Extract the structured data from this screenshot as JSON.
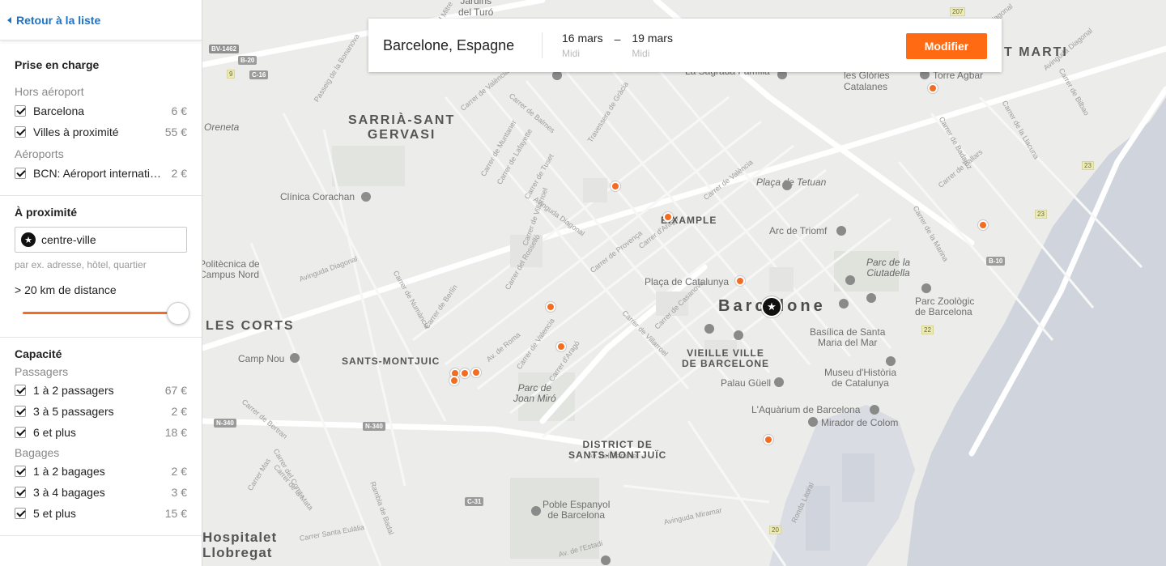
{
  "sidebar": {
    "back_label": "Retour à la liste",
    "pickup": {
      "title": "Prise en charge",
      "group_off_airport": "Hors aéroport",
      "off_airport": [
        {
          "label": "Barcelona",
          "price": "6 €"
        },
        {
          "label": "Villes à proximité",
          "price": "55 €"
        }
      ],
      "group_airports": "Aéroports",
      "airports": [
        {
          "label": "BCN: Aéroport international de Barcelone",
          "price": "2 €"
        }
      ]
    },
    "nearby": {
      "title": "À proximité",
      "input_value": "centre-ville",
      "hint": "par ex. adresse, hôtel, quartier",
      "distance_label": "> 20 km de distance",
      "slider_level": 1.0
    },
    "capacity": {
      "title": "Capacité",
      "group_passengers": "Passagers",
      "passengers": [
        {
          "label": "1 à 2 passagers",
          "price": "67 €"
        },
        {
          "label": "3 à 5 passagers",
          "price": "2 €"
        },
        {
          "label": "6 et plus",
          "price": "18 €"
        }
      ],
      "group_bags": "Bagages",
      "bags": [
        {
          "label": "1 à 2 bagages",
          "price": "2 €"
        },
        {
          "label": "3 à 4 bagages",
          "price": "3 €"
        },
        {
          "label": "5 et plus",
          "price": "15 €"
        }
      ]
    }
  },
  "search": {
    "destination": "Barcelone, Espagne",
    "start_date": "16 mars",
    "start_time": "Midi",
    "dash": "–",
    "end_date": "19 mars",
    "end_time": "Midi",
    "modify_label": "Modifier"
  },
  "map": {
    "city": "Barcelone",
    "districts": {
      "sarria": [
        "SARRIÀ-SANT",
        "GERVASI"
      ],
      "sant_marti": "T MARTI",
      "les_corts": "LES CORTS",
      "eixample": "EIXAMPLE",
      "sants": "SANTS-MONTJUIC",
      "vieille": [
        "VIEILLE VILLE",
        "DE BARCELONE"
      ],
      "district": [
        "DISTRICT DE",
        "SANTS-MONTJUÏC"
      ],
      "hospitalet": [
        "Hospitalet",
        "Llobregat"
      ]
    },
    "places": {
      "jardins": [
        "Jardins",
        "del Turó"
      ],
      "sagrada": "La Sagrada Família",
      "glories": [
        "les Glòries",
        "Catalanes"
      ],
      "torre": "Torre Agbar",
      "oreneta": "Oreneta",
      "clinica": "Clínica Corachan",
      "placa_tetuan": "Plaça de Tetuan",
      "arc": "Arc de Triomf",
      "parc_ciutadella": [
        "Parc de la",
        "Ciutadella"
      ],
      "politecnica": [
        "Politècnica de",
        "Campus Nord"
      ],
      "placa_catalunya": "Plaça de Catalunya",
      "parc_zoo": [
        "Parc Zoològic",
        "de Barcelona"
      ],
      "basilica": [
        "Basílica de Santa",
        "Maria del Mar"
      ],
      "camp_nou": "Camp Nou",
      "palau": "Palau Güell",
      "museu": [
        "Museu d'Història",
        "de Catalunya"
      ],
      "parc_miro": [
        "Parc de",
        "Joan Miró"
      ],
      "aquarium": "L'Aquàrium de Barcelona",
      "mirador": "Mirador de Colom",
      "poble": [
        "Poble Espanyol",
        "de Barcelona"
      ]
    },
    "streets": {
      "diagonal_top": "Avinguda Diagonal",
      "bolonia": "Passeig de la Bonanova",
      "ronda_mitre": "Ronda General Mitre",
      "balmes": "Carrer de Balmes",
      "gracia": "Travessera de Gràcia",
      "muntaner": "Carrer de Muntaner",
      "lafayette": "Carrer de Lafayette",
      "tuset": "Carrer de Tuset",
      "diagonal_mid": "Avinguda Diagonal",
      "valencia": "Carrer de València",
      "provenca": "Carrer de Provença",
      "arago": "Carrer d'Aragó",
      "villarroel": "Carrer de Villarroel",
      "rossello": "Carrer del Rosselló",
      "numancia": "Carrer de Numància",
      "berlin": "Carrer de Berlín",
      "roma": "Av. de Roma",
      "valencia2": "Carrer de Valencia",
      "arago2": "Carrer d'Aragó",
      "cesarie": "Carrer de Casanova",
      "villarroel2": "Carrer de Villarroel",
      "parallel": "Av. del Paral·lel",
      "mas": "Carrer Mas",
      "mata": "Carrer de la Mata",
      "badal": "Rambla de Badal",
      "santa_eulalia": "Carrer Santa Eulàlia",
      "estadi": "Av. de l'Estadi",
      "miramar": "Avinguda Miramar",
      "litoral": "Ronda Litoral",
      "badajoz": "Carrer de Badajoz",
      "pallars": "Carrer de Pallars",
      "marina": "Carrer de la Marina",
      "lacuna": "Carrer de la Llacuna",
      "bilbao": "Carrer de Bilbao",
      "diagonal_east": "Avinguda Diagonal",
      "diagonal_w": "Avinguda Diagonal",
      "valencia3": "Carrer de València",
      "cortes": "Carrer del Comte",
      "bertran": "Carrer de Bertran"
    },
    "road_badges": {
      "bv": "BV-1462",
      "b20": "B-20",
      "c16": "C-16",
      "nine": "9",
      "n340a": "N-340",
      "n340b": "N-340",
      "c31": "C-31",
      "b10": "B-10",
      "r207": "207",
      "r23a": "23",
      "r23b": "23",
      "r22": "22",
      "r20": "20"
    }
  }
}
